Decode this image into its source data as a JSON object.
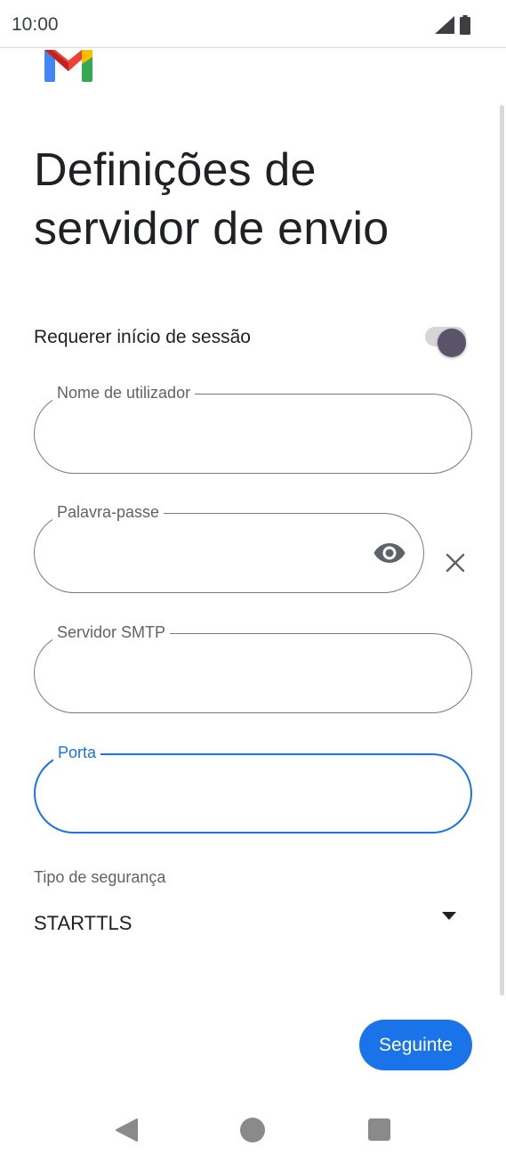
{
  "status_bar": {
    "time": "10:00"
  },
  "icons": {
    "logo": "gmail-logo",
    "signal": "signal-icon",
    "battery": "battery-icon",
    "eye": "visibility-icon",
    "clear": "close-icon",
    "dropdown": "dropdown-arrow-icon"
  },
  "page": {
    "title": "Definições de servidor de envio"
  },
  "require_login": {
    "label": "Requerer início de sessão",
    "enabled": true
  },
  "fields": {
    "username": {
      "label": "Nome de utilizador",
      "value": ""
    },
    "password": {
      "label": "Palavra-passe",
      "value": ""
    },
    "smtp_server": {
      "label": "Servidor SMTP",
      "value": ""
    },
    "port": {
      "label": "Porta",
      "value": ""
    }
  },
  "security": {
    "label": "Tipo de segurança",
    "selected": "STARTTLS"
  },
  "actions": {
    "next_label": "Seguinte"
  },
  "colors": {
    "accent": "#1a73e8",
    "toggle_thumb": "#5a5469",
    "toggle_track": "#d7d5da"
  }
}
